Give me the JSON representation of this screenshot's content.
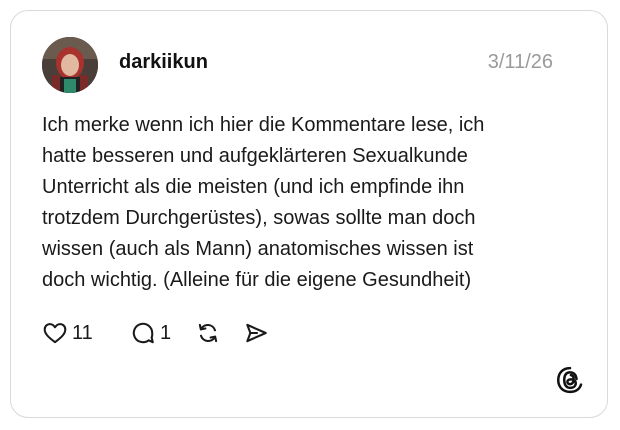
{
  "post": {
    "username": "darkiikun",
    "date": "3/11/26",
    "text_lines": [
      "Ich merke wenn ich hier die Kommentare lese, ich",
      "hatte besseren und aufgeklärteren Sexualkunde",
      "Unterricht als die meisten (und ich empfinde ihn",
      "trotzdem Durchgerüstes), sowas sollte man doch",
      "wissen (auch als Mann) anatomisches wissen ist",
      "doch wichtig. (Alleine für die eigene Gesundheit)"
    ]
  },
  "actions": {
    "likes": "11",
    "comments": "1",
    "like_icon": "heart-icon",
    "comment_icon": "speech-bubble-icon",
    "repost_icon": "repost-icon",
    "share_icon": "send-icon"
  },
  "brand": {
    "logo_icon": "threads-logo-icon"
  },
  "colors": {
    "text": "#111111",
    "muted": "#9a9a9a",
    "border": "#d9d9d9"
  }
}
